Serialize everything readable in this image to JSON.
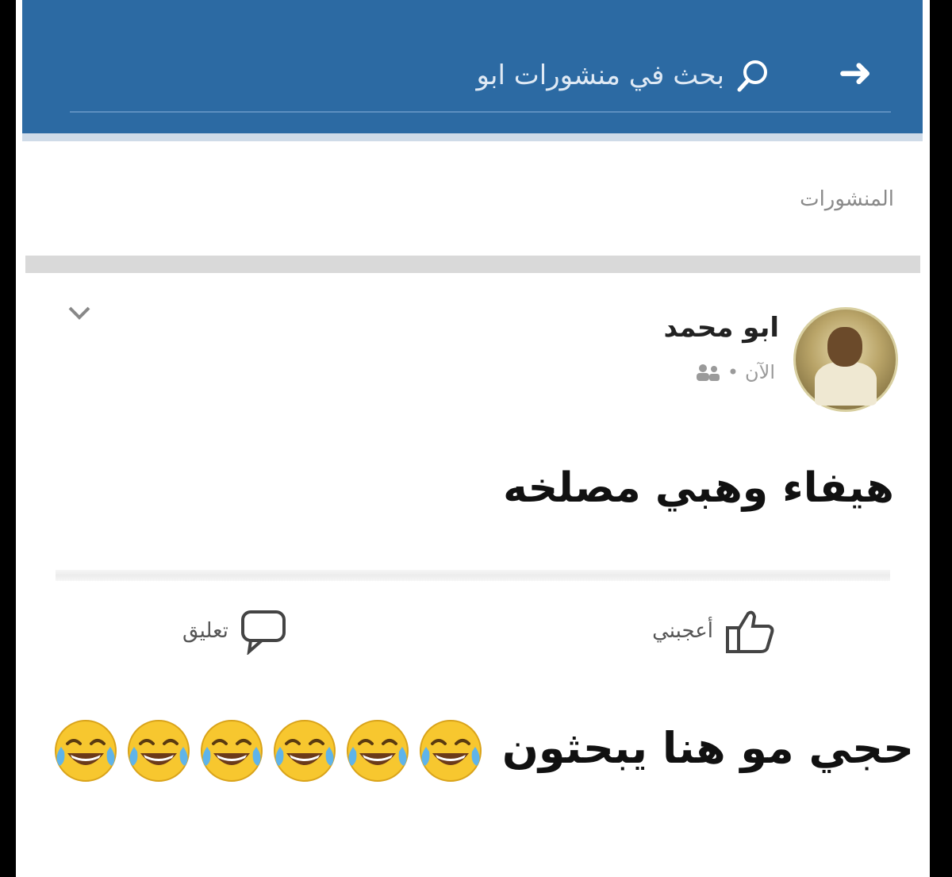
{
  "search": {
    "placeholder": "بحث في منشورات ابو"
  },
  "section": {
    "posts_label": "المنشورات"
  },
  "post": {
    "author": "ابو محمد",
    "time": "الآن",
    "separator": "•",
    "text": "هيفاء وهبي مصلخه",
    "actions": {
      "like_label": "أعجبني",
      "comment_label": "تعليق"
    }
  },
  "comment": {
    "text": "حجي مو هنا يبحثون",
    "emoji_name": "face-with-tears-of-joy",
    "emoji_count": 6
  },
  "colors": {
    "header": "#2c6aa3",
    "emoji_yellow": "#f7c72f"
  }
}
